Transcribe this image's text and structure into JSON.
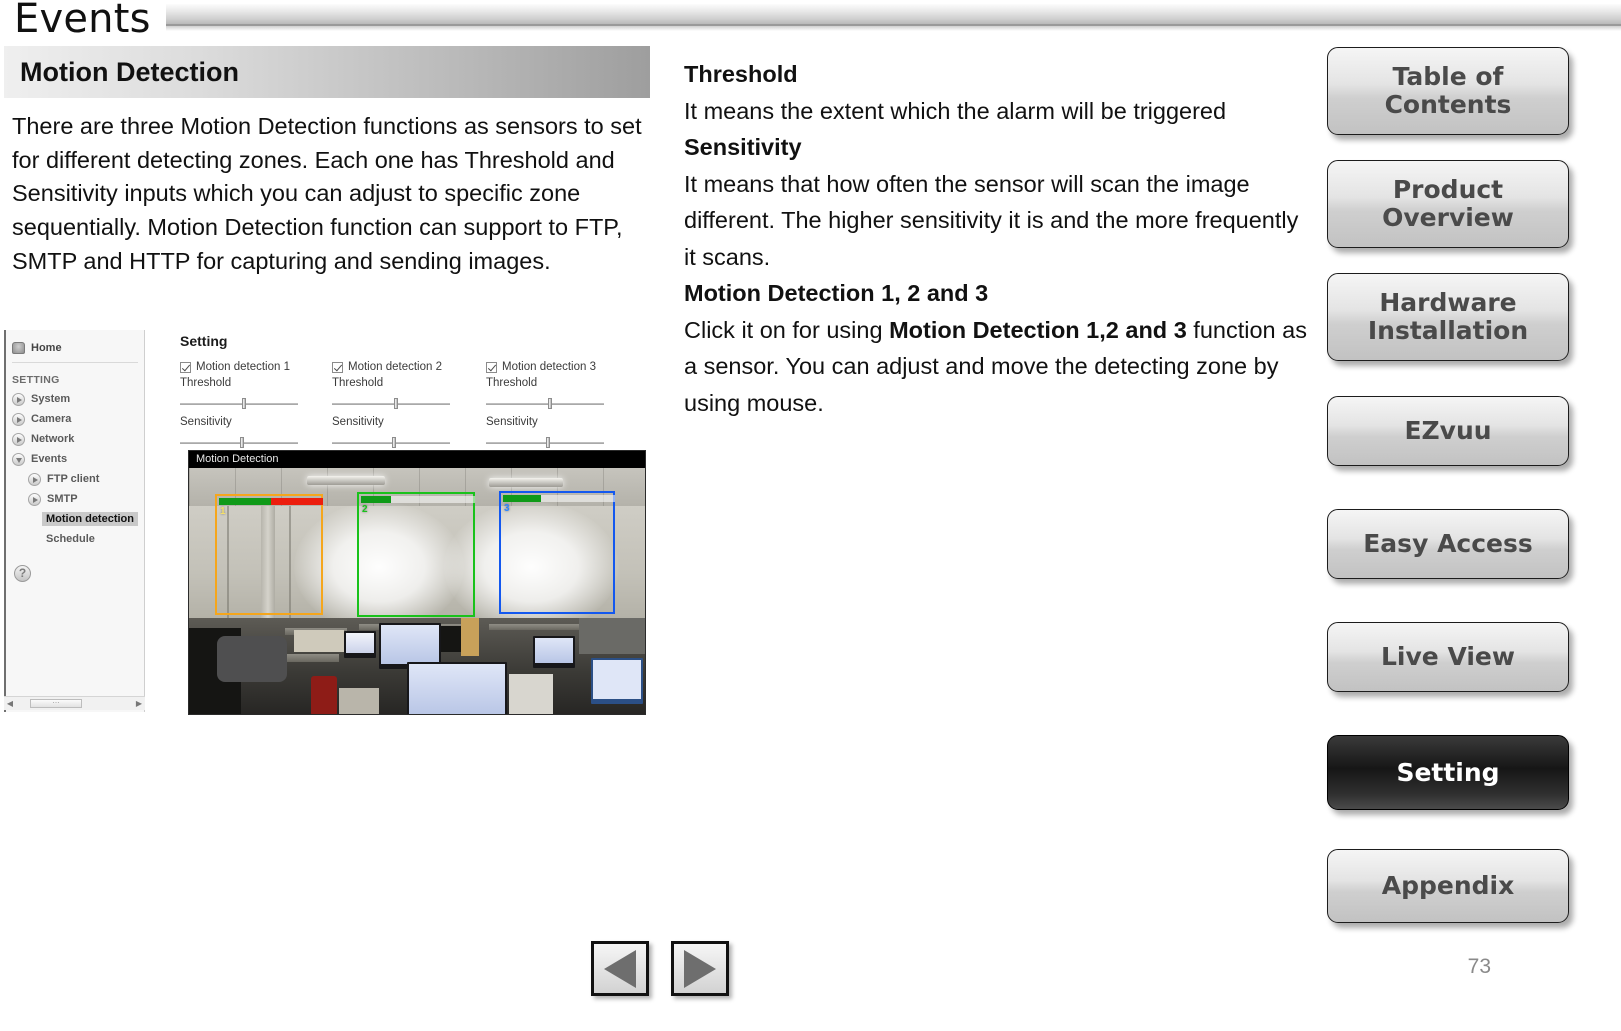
{
  "header": {
    "tab_label": "Events"
  },
  "section": {
    "title": "Motion Detection"
  },
  "left_column": {
    "paragraph": "There are three Motion Detection functions as sensors to set for different detecting zones. Each one has Threshold and Sensitivity inputs which you can adjust to specific zone sequentially. Motion Detection function can support to FTP, SMTP and HTTP for capturing and sending images."
  },
  "right_column": {
    "threshold_heading": "Threshold",
    "threshold_text": "It means the extent which the alarm will be triggered",
    "sensitivity_heading": "Sensitivity",
    "sensitivity_text": "It means that how often the sensor will scan the image different. The higher sensitivity it is and the more frequently it scans.",
    "md_heading": "Motion Detection 1, 2 and 3",
    "md_text_pre": "Click it on for using ",
    "md_text_bold": "Motion Detection 1,2 and 3",
    "md_text_post": " function as a sensor. You can adjust and move the detecting zone by using mouse."
  },
  "camera_ui": {
    "nav": {
      "home_label": "Home",
      "group_label": "SETTING",
      "items": [
        {
          "label": "System",
          "icon": "arrow-right-icon",
          "level": 0,
          "selected": false
        },
        {
          "label": "Camera",
          "icon": "arrow-right-icon",
          "level": 0,
          "selected": false
        },
        {
          "label": "Network",
          "icon": "arrow-right-icon",
          "level": 0,
          "selected": false
        },
        {
          "label": "Events",
          "icon": "arrow-down-icon",
          "level": 0,
          "selected": false
        },
        {
          "label": "FTP client",
          "icon": "arrow-right-icon",
          "level": 1,
          "selected": false
        },
        {
          "label": "SMTP",
          "icon": "arrow-right-icon",
          "level": 1,
          "selected": false
        },
        {
          "label": "Motion detection",
          "icon": "",
          "level": 2,
          "selected": true
        },
        {
          "label": "Schedule",
          "icon": "",
          "level": 2,
          "selected": false
        }
      ],
      "help_glyph": "?",
      "scroll_left_glyph": "◀",
      "scroll_right_glyph": "▶",
      "scroll_thumb_glyph": "⋯"
    },
    "setting_title": "Setting",
    "columns": [
      {
        "checkbox_label": "Motion detection 1",
        "checked": true,
        "threshold_label": "Threshold",
        "threshold_value": 52,
        "sensitivity_label": "Sensitivity",
        "sensitivity_value": 50
      },
      {
        "checkbox_label": "Motion detection 2",
        "checked": true,
        "threshold_label": "Threshold",
        "threshold_value": 52,
        "sensitivity_label": "Sensitivity",
        "sensitivity_value": 50
      },
      {
        "checkbox_label": "Motion detection 3",
        "checked": true,
        "threshold_label": "Threshold",
        "threshold_value": 52,
        "sensitivity_label": "Sensitivity",
        "sensitivity_value": 50
      }
    ],
    "video": {
      "overlay_title": "Motion Detection",
      "zones": [
        {
          "number": "1",
          "color": "#f5a61c",
          "bar_green_pct": 50,
          "bar_red_pct": 50
        },
        {
          "number": "2",
          "color": "#19c21b",
          "bar_green_pct": 26,
          "bar_red_pct": 0
        },
        {
          "number": "3",
          "color": "#1358ef",
          "bar_green_pct": 34,
          "bar_red_pct": 0
        }
      ]
    }
  },
  "sidebar": {
    "buttons": [
      {
        "label": "Table of Contents",
        "active": false
      },
      {
        "label": "Product Overview",
        "active": false
      },
      {
        "label": "Hardware Installation",
        "active": false
      },
      {
        "label": "EZvuu",
        "active": false
      },
      {
        "label": "Easy Access",
        "active": false
      },
      {
        "label": "Live View",
        "active": false
      },
      {
        "label": "Setting",
        "active": true
      },
      {
        "label": "Appendix",
        "active": false
      }
    ]
  },
  "footer": {
    "prev_label": "Previous page",
    "next_label": "Next page",
    "page_number": "73"
  },
  "colors": {
    "zone1": "#f5a61c",
    "zone2": "#19c21b",
    "zone3": "#1358ef",
    "bar_green": "#0f9a18",
    "bar_red": "#ec1d0d",
    "active_button_bg": "#161616",
    "page_number": "#8a8a8a"
  }
}
